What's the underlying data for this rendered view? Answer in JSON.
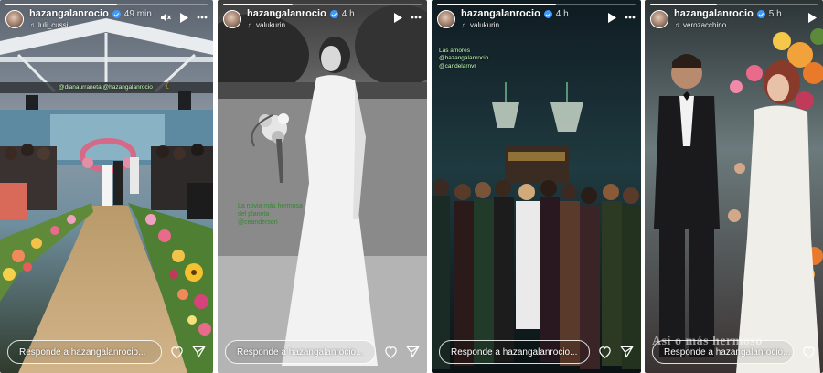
{
  "stories": [
    {
      "username": "hazangalanrocio",
      "time": "49 min",
      "music": "luli_cussi",
      "progress": 0.55,
      "reply_placeholder": "Responde a hazangalanrocio...",
      "overlay": "@dianaurraneta @hazangalanrocio"
    },
    {
      "username": "hazangalanrocio",
      "time": "4 h",
      "music": "valukurin",
      "progress": 0.35,
      "reply_placeholder": "Responde a hazangalanrocio...",
      "caption": [
        "La novia más hermosa",
        "del planeta",
        "@ceanderson"
      ]
    },
    {
      "username": "hazangalanrocio",
      "time": "4 h",
      "music": "valukurin",
      "progress": 0.6,
      "reply_placeholder": "Responde a hazangalanrocio...",
      "overlay": [
        "Las amores",
        "@hazangalanrocio",
        "@candelarnvr"
      ]
    },
    {
      "username": "hazangalanrocio",
      "time": "5 h",
      "music": "verozacchino",
      "progress": 0.4,
      "reply_placeholder": "Responde a hazangalanrocio...",
      "watermark": "Así o más hermoso"
    }
  ],
  "icons": {
    "mute": "mute-icon",
    "play": "play-icon",
    "more": "more-icon",
    "heart": "heart-icon",
    "send": "send-icon",
    "music": "music-icon"
  },
  "colors": {
    "verified": "#3d9bff",
    "caption_green": "#2f8a2a"
  }
}
